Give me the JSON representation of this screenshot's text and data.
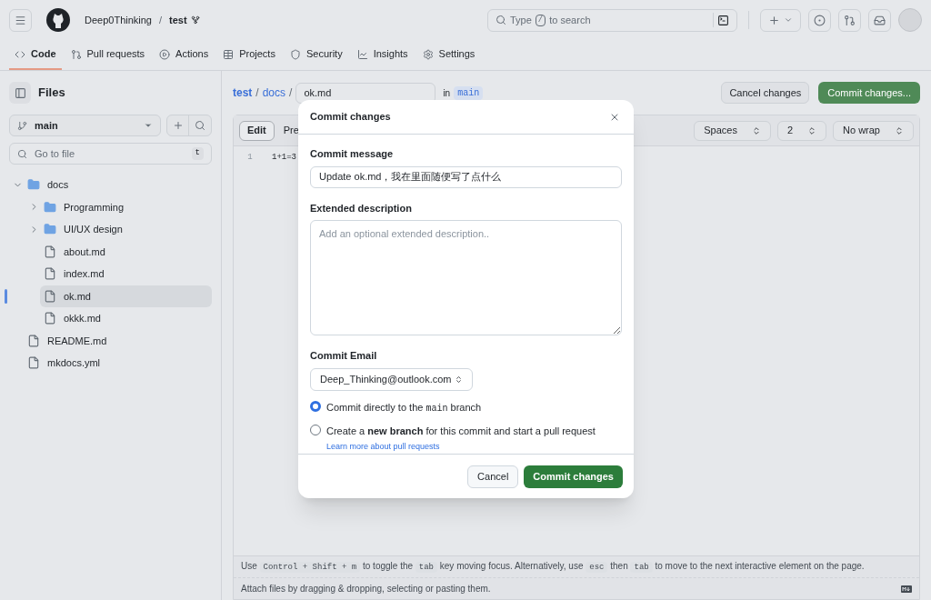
{
  "header": {
    "owner": "Deep0Thinking",
    "separator": "/",
    "repo": "test",
    "search": {
      "before": "Type",
      "key": "/",
      "after": "to search"
    }
  },
  "nav_tabs": [
    {
      "label": "Code",
      "selected": true
    },
    {
      "label": "Pull requests",
      "selected": false
    },
    {
      "label": "Actions",
      "selected": false
    },
    {
      "label": "Projects",
      "selected": false
    },
    {
      "label": "Security",
      "selected": false
    },
    {
      "label": "Insights",
      "selected": false
    },
    {
      "label": "Settings",
      "selected": false
    }
  ],
  "sidebar": {
    "title": "Files",
    "branch": "main",
    "goto": {
      "placeholder": "Go to file",
      "shortcut": "t"
    },
    "tree": [
      {
        "name": "docs",
        "kind": "folder",
        "expanded": true,
        "selected": false,
        "children": [
          {
            "name": "Programming",
            "kind": "folder",
            "expanded": false,
            "selected": false
          },
          {
            "name": "UI/UX design",
            "kind": "folder",
            "expanded": false,
            "selected": false
          },
          {
            "name": "about.md",
            "kind": "file",
            "selected": false
          },
          {
            "name": "index.md",
            "kind": "file",
            "selected": false
          },
          {
            "name": "ok.md",
            "kind": "file",
            "selected": true
          },
          {
            "name": "okkk.md",
            "kind": "file",
            "selected": false
          }
        ]
      },
      {
        "name": "README.md",
        "kind": "file",
        "selected": false
      },
      {
        "name": "mkdocs.yml",
        "kind": "file",
        "selected": false
      }
    ]
  },
  "editor": {
    "breadcrumb": [
      "test",
      "docs"
    ],
    "separator": "/",
    "filename": "ok.md",
    "in": "in",
    "branch": "main",
    "cancel_button": "Cancel changes",
    "commit_button": "Commit changes...",
    "tabs": [
      {
        "label": "Edit",
        "selected": true
      },
      {
        "label": "Pre",
        "selected": false
      }
    ],
    "selects": [
      "Spaces",
      "2",
      "No wrap"
    ],
    "lines": [
      {
        "number": "1",
        "text": "1+1=3"
      }
    ],
    "help": [
      {
        "kind": "text",
        "text": "Use"
      },
      {
        "kind": "kbd",
        "text": "Control + Shift + m"
      },
      {
        "kind": "text",
        "text": "to toggle the"
      },
      {
        "kind": "kbd",
        "text": "tab"
      },
      {
        "kind": "text",
        "text": "key moving focus. Alternatively, use"
      },
      {
        "kind": "kbd",
        "text": "esc"
      },
      {
        "kind": "text",
        "text": "then"
      },
      {
        "kind": "kbd",
        "text": "tab"
      },
      {
        "kind": "text",
        "text": "to move to the next interactive element on the page."
      }
    ],
    "attach": "Attach files by dragging & dropping, selecting or pasting them."
  },
  "dialog": {
    "title": "Commit changes",
    "message_label": "Commit message",
    "message_value": "Update ok.md，我在里面随便写了点什么",
    "description_label": "Extended description",
    "description_placeholder": "Add an optional extended description..",
    "email_label": "Commit Email",
    "email_value": "Deep_Thinking@outlook.com",
    "options": [
      {
        "selected": true,
        "parts": [
          {
            "kind": "text",
            "text": "Commit directly to the"
          },
          {
            "kind": "code",
            "text": "main"
          },
          {
            "kind": "text",
            "text": "branch"
          }
        ]
      },
      {
        "selected": false,
        "parts": [
          {
            "kind": "rich",
            "text": "Create a **new branch** for this commit and start a pull request"
          }
        ],
        "link": "Learn more about pull requests"
      }
    ],
    "cancel": "Cancel",
    "submit": "Commit changes"
  }
}
